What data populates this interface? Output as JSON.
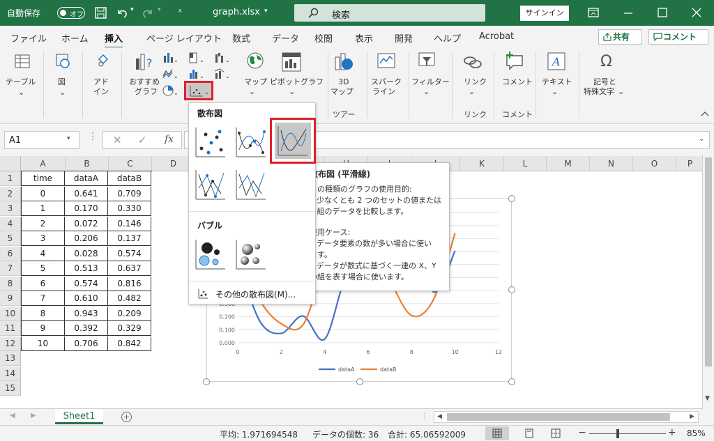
{
  "titlebar": {
    "autosave": "自動保存",
    "autosave_state": "オフ",
    "filename": "graph.xlsx",
    "search": "検索",
    "signin": "サインイン"
  },
  "tabs": [
    "ファイル",
    "ホーム",
    "挿入",
    "ページ レイアウト",
    "数式",
    "データ",
    "校閲",
    "表示",
    "開発",
    "ヘルプ",
    "Acrobat"
  ],
  "share": "共有",
  "comment": "コメント",
  "ribbon": {
    "table": "テーブル",
    "illust": "図",
    "addin1": "アド",
    "addin2": "イン",
    "rec1": "おすすめ",
    "rec2": "グラフ",
    "map": "マップ",
    "pivot": "ピボットグラフ",
    "map3d1": "3D",
    "map3d2": "マップ",
    "tour": "ツアー",
    "spark1": "スパーク",
    "spark2": "ライン",
    "filter": "フィルター",
    "link": "リンク",
    "link_group": "リンク",
    "comment": "コメント",
    "comment_group": "コメント",
    "text": "テキスト",
    "symbol1": "記号と",
    "symbol2": "特殊文字"
  },
  "namebox": "A1",
  "fx": "fx",
  "columns": [
    "A",
    "B",
    "C",
    "D",
    "E",
    "F",
    "G",
    "H",
    "I",
    "J",
    "K",
    "L",
    "M",
    "N",
    "O",
    "P"
  ],
  "rows": [
    "1",
    "2",
    "3",
    "4",
    "5",
    "6",
    "7",
    "8",
    "9",
    "10",
    "11",
    "12",
    "13",
    "14",
    "15"
  ],
  "table": {
    "headers": [
      "time",
      "dataA",
      "dataB"
    ],
    "rows": [
      [
        "0",
        "0.641",
        "0.709"
      ],
      [
        "1",
        "0.170",
        "0.330"
      ],
      [
        "2",
        "0.072",
        "0.146"
      ],
      [
        "3",
        "0.206",
        "0.137"
      ],
      [
        "4",
        "0.028",
        "0.574"
      ],
      [
        "5",
        "0.513",
        "0.637"
      ],
      [
        "6",
        "0.574",
        "0.816"
      ],
      [
        "7",
        "0.610",
        "0.482"
      ],
      [
        "8",
        "0.943",
        "0.209"
      ],
      [
        "9",
        "0.392",
        "0.329"
      ],
      [
        "10",
        "0.706",
        "0.842"
      ]
    ]
  },
  "dropdown": {
    "scatter_header": "散布図",
    "bubble_header": "バブル",
    "more": "その他の散布図(M)..."
  },
  "tooltip": {
    "title": "散布図 (平滑線)",
    "l1": "この種類のグラフの使用目的:",
    "l2": "• 少なくとも 2 つのセットの値または",
    "l3": "2 組のデータを比較します。",
    "l4": "使用ケース:",
    "l5": "• データ要素の数が多い場合に使い",
    "l6": "ます。",
    "l7": "• データが数式に基づく一連の X、Y",
    "l8": "の組を表す場合に使います。"
  },
  "chart_data": {
    "type": "scatter",
    "x": [
      0,
      1,
      2,
      3,
      4,
      5,
      6,
      7,
      8,
      9,
      10
    ],
    "series": [
      {
        "name": "dataA",
        "color": "#4472c4",
        "values": [
          0.641,
          0.17,
          0.072,
          0.206,
          0.028,
          0.513,
          0.574,
          0.61,
          0.943,
          0.392,
          0.706
        ]
      },
      {
        "name": "dataB",
        "color": "#ed7d31",
        "values": [
          0.709,
          0.33,
          0.146,
          0.137,
          0.574,
          0.637,
          0.816,
          0.482,
          0.209,
          0.329,
          0.842
        ]
      }
    ],
    "xticks": [
      "0",
      "2",
      "4",
      "6",
      "8",
      "10",
      "12"
    ],
    "yticks": [
      "0.000",
      "0.100",
      "0.200",
      "0.300"
    ],
    "xlim": [
      0,
      12
    ],
    "ylim": [
      0,
      1
    ]
  },
  "sheet": "Sheet1",
  "status": {
    "avg": "平均: 1.971694548",
    "count": "データの個数: 36",
    "sum": "合計: 65.06592009",
    "zoom": "85%"
  }
}
